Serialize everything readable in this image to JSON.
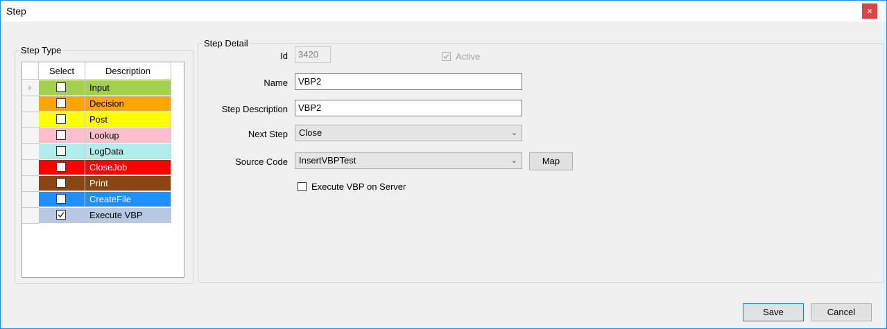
{
  "window": {
    "title": "Step",
    "close_glyph": "×"
  },
  "step_type": {
    "legend": "Step Type",
    "col_select": "Select",
    "col_description": "Description",
    "rows": [
      {
        "label": "Input",
        "color": "#a3d14b",
        "checked": false,
        "current": true
      },
      {
        "label": "Decision",
        "color": "#ffa500",
        "checked": false
      },
      {
        "label": "Post",
        "color": "#ffff00",
        "checked": false
      },
      {
        "label": "Lookup",
        "color": "#ffc0cb",
        "checked": false
      },
      {
        "label": "LogData",
        "color": "#b0eeee",
        "checked": false
      },
      {
        "label": "CloseJob",
        "color": "#ff0000",
        "checked": false,
        "text_color": "#ffffff"
      },
      {
        "label": "Print",
        "color": "#8b4513",
        "checked": false,
        "text_color": "#ffffff"
      },
      {
        "label": "CreateFile",
        "color": "#1e90ff",
        "checked": false,
        "text_color": "#ffffff"
      },
      {
        "label": "Execute VBP",
        "color": "#b7c9e2",
        "checked": true
      }
    ]
  },
  "step_detail": {
    "legend": "Step Detail",
    "id_label": "Id",
    "id_value": "3420",
    "active_label": "Active",
    "active_checked": true,
    "name_label": "Name",
    "name_value": "VBP2",
    "desc_label": "Step Description",
    "desc_value": "VBP2",
    "next_label": "Next Step",
    "next_value": "Close",
    "source_label": "Source Code",
    "source_value": "InsertVBPTest",
    "map_label": "Map",
    "exec_label": "Execute VBP on Server",
    "exec_checked": false
  },
  "footer": {
    "save": "Save",
    "cancel": "Cancel"
  }
}
